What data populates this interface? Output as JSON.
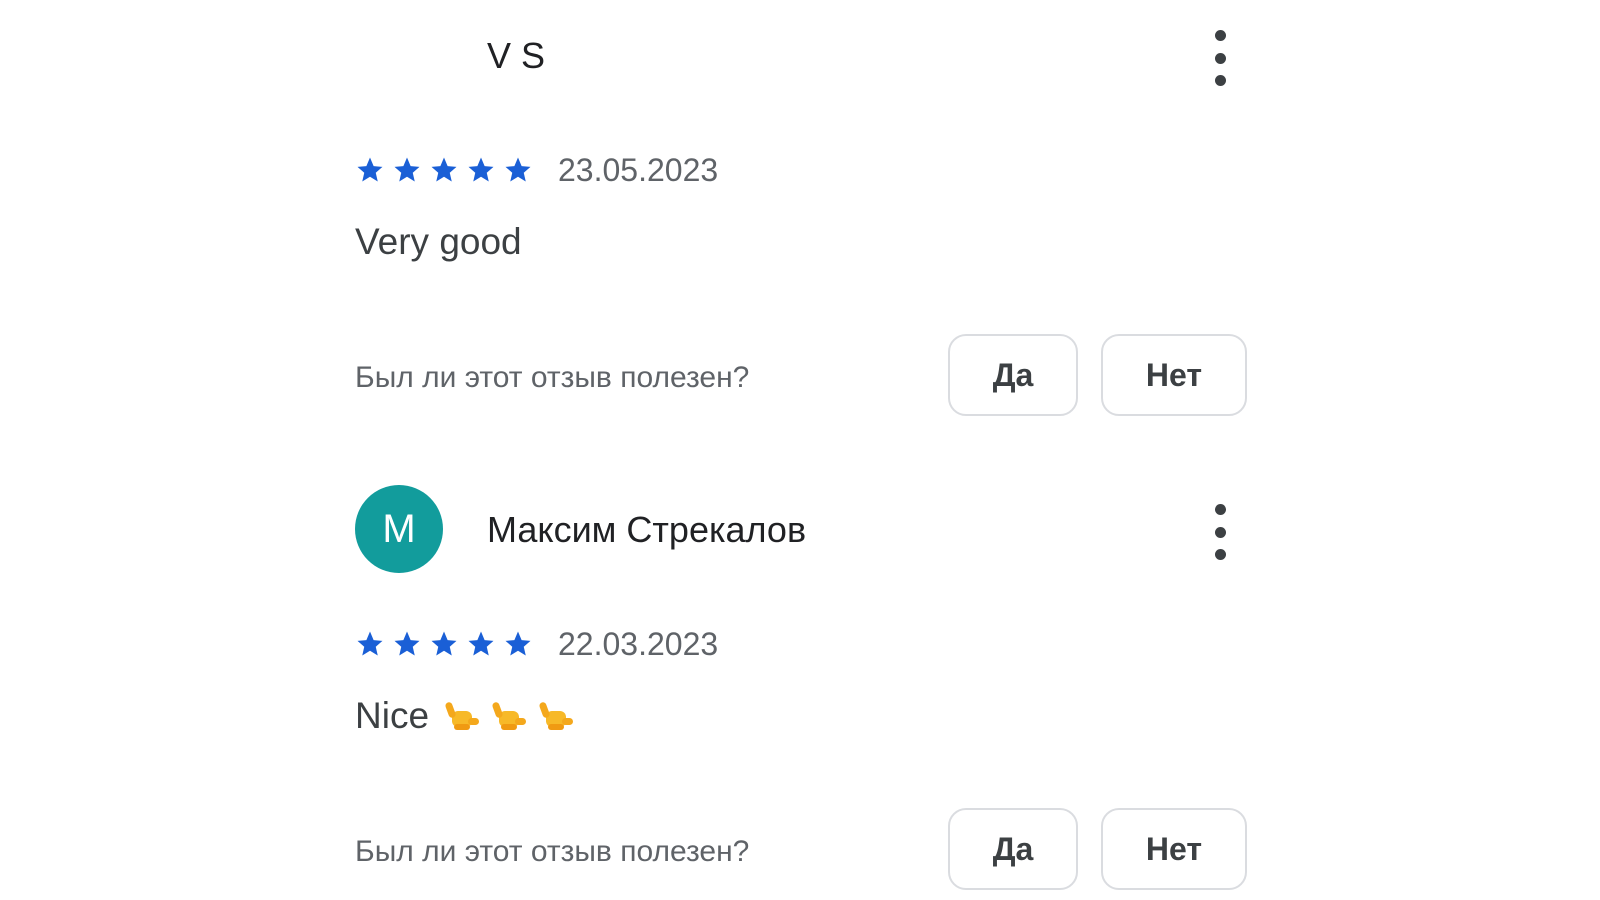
{
  "reviews": [
    {
      "author": "V S",
      "avatar_letter": "",
      "avatar_color": "",
      "rating": 5,
      "date": "23.05.2023",
      "text": "Very good",
      "emojis": [],
      "helpful_question": "Был ли этот отзыв полезен?",
      "yes_label": "Да",
      "no_label": "Нет"
    },
    {
      "author": "Максим Стрекалов",
      "avatar_letter": "M",
      "avatar_color": "#129c9c",
      "rating": 5,
      "date": "22.03.2023",
      "text": "Nice",
      "emojis": [
        "call-me-hand-emoji",
        "call-me-hand-emoji",
        "call-me-hand-emoji"
      ],
      "helpful_question": "Был ли этот отзыв полезен?",
      "yes_label": "Да",
      "no_label": "Нет"
    }
  ],
  "colors": {
    "star": "#1a5fd6",
    "avatar": "#129c9c",
    "text": "#3c4043",
    "muted": "#5f6368",
    "border": "#dadce0"
  },
  "icons": {
    "menu": "more-vert-icon",
    "star": "star-icon"
  }
}
